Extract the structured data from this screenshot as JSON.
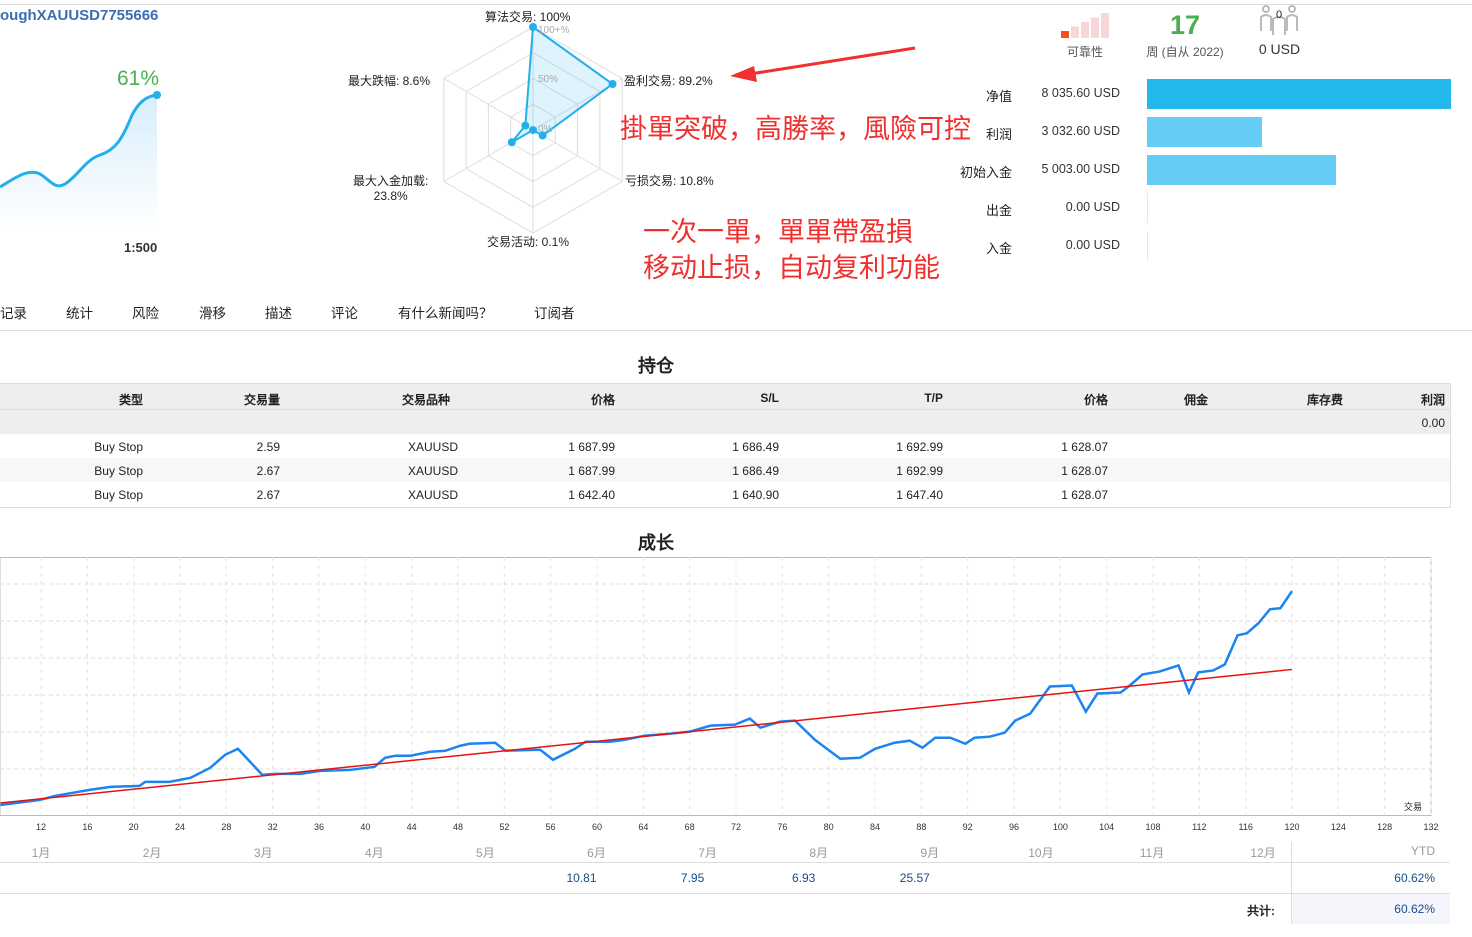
{
  "header": {
    "title": "oughXAUUSD7755666",
    "growth_pct": "61%",
    "leverage": "1:500"
  },
  "radar": {
    "axes": [
      {
        "label": "算法交易: 100%",
        "value": 100
      },
      {
        "label": "盈利交易: 89.2%",
        "value": 89.2
      },
      {
        "label": "亏损交易: 10.8%",
        "value": 10.8
      },
      {
        "label": "交易活动: 0.1%",
        "value": 0.1
      },
      {
        "label": "最大入金加载:",
        "label2": "23.8%",
        "value": 23.8
      },
      {
        "label": "最大跌幅: 8.6%",
        "value": 8.6
      }
    ],
    "ring_labels": [
      "100+%",
      "50%",
      "0%"
    ]
  },
  "annotations": {
    "line1": "掛單突破，高勝率，風險可控",
    "line2": "一次一單，單單帶盈損",
    "line3": "移动止损，自动复利功能"
  },
  "stats": {
    "reliability_label": "可靠性",
    "reliability_level": 1,
    "reliability_max": 5,
    "weeks": "17",
    "weeks_label": "周 (自从 2022)",
    "subscribers": "0",
    "subscription_price": "0 USD"
  },
  "finance": [
    {
      "label": "净值",
      "value": "8 035.60 USD",
      "amount": 8035.6,
      "color": "#22b8ec"
    },
    {
      "label": "利润",
      "value": "3 032.60 USD",
      "amount": 3032.6,
      "color": "#63cdf5"
    },
    {
      "label": "初始入金",
      "value": "5 003.00 USD",
      "amount": 5003.0,
      "color": "#63cdf5"
    },
    {
      "label": "出金",
      "value": "0.00 USD",
      "amount": 0,
      "color": "#63cdf5"
    },
    {
      "label": "入金",
      "value": "0.00 USD",
      "amount": 0,
      "color": "#63cdf5"
    }
  ],
  "tabs": [
    "记录",
    "统计",
    "风险",
    "滑移",
    "描述",
    "评论",
    "有什么新闻吗？",
    "订阅者"
  ],
  "positions": {
    "title": "持仓",
    "headers": [
      "类型",
      "交易量",
      "交易品种",
      "价格",
      "S/L",
      "T/P",
      "价格",
      "佣金",
      "库存费",
      "利润"
    ],
    "total_profit": "0.00",
    "rows": [
      [
        "Buy Stop",
        "2.59",
        "XAUUSD",
        "1 687.99",
        "1 686.49",
        "1 692.99",
        "1 628.07"
      ],
      [
        "Buy Stop",
        "2.67",
        "XAUUSD",
        "1 687.99",
        "1 686.49",
        "1 692.99",
        "1 628.07"
      ],
      [
        "Buy Stop",
        "2.67",
        "XAUUSD",
        "1 642.40",
        "1 640.90",
        "1 647.40",
        "1 628.07"
      ]
    ]
  },
  "growth": {
    "title": "成长",
    "x_axis_label": "交易",
    "chart_data": {
      "type": "line",
      "title": "成长",
      "xlabel": "交易",
      "xlim": [
        8.46,
        132
      ],
      "ylim": [
        -10,
        247
      ],
      "xticks": [
        12,
        16,
        20,
        24,
        28,
        32,
        36,
        40,
        44,
        48,
        52,
        56,
        60,
        64,
        68,
        72,
        76,
        80,
        84,
        88,
        92,
        96,
        100,
        104,
        108,
        112,
        116,
        120,
        124,
        128,
        132
      ],
      "series": [
        {
          "name": "growth",
          "color": "#1a84f0",
          "x": [
            8.5,
            11.9,
            13.2,
            16.2,
            18.0,
            20.5,
            21.0,
            23.1,
            24.9,
            26.6,
            27.9,
            29.0,
            31.1,
            32.2,
            34.4,
            36.1,
            38.7,
            40.8,
            41.7,
            42.6,
            43.9,
            45.6,
            46.9,
            48.2,
            49.0,
            51.2,
            52.1,
            55.1,
            56.2,
            58.1,
            59.0,
            61.1,
            62.4,
            64.1,
            66.3,
            68.0,
            69.8,
            71.9,
            73.2,
            74.1,
            75.8,
            77.1,
            78.8,
            81.0,
            82.7,
            84.0,
            85.7,
            87.0,
            88.1,
            89.2,
            90.5,
            91.8,
            92.6,
            93.9,
            95.2,
            96.1,
            97.4,
            99.1,
            101.0,
            102.2,
            103.2,
            105.2,
            106.0,
            107.1,
            108.6,
            110.2,
            111.1,
            111.9,
            113.2,
            114.2,
            115.3,
            116.1,
            117.1,
            118.1,
            119.0,
            120
          ],
          "y": [
            0,
            5,
            9,
            15,
            18,
            19,
            23,
            23,
            27,
            37,
            50,
            56,
            30,
            31,
            31,
            34,
            35,
            38,
            47,
            49,
            49,
            53,
            54,
            59,
            61,
            62,
            54,
            55,
            45,
            56,
            63,
            63,
            65,
            69,
            71,
            73,
            79,
            80,
            86,
            77,
            83,
            84,
            65,
            46,
            47,
            56,
            62,
            64,
            57,
            67,
            67,
            61,
            67,
            68,
            72,
            84,
            91,
            118,
            119,
            93,
            111,
            112,
            119,
            130,
            133,
            139,
            112,
            132,
            134,
            140,
            169,
            171,
            181,
            195,
            196,
            213
          ]
        },
        {
          "name": "trend",
          "color": "#e81010",
          "x": [
            8.5,
            120
          ],
          "y": [
            2,
            135
          ]
        }
      ]
    }
  },
  "monthly": {
    "months": [
      "1月",
      "2月",
      "3月",
      "4月",
      "5月",
      "6月",
      "7月",
      "8月",
      "9月",
      "10月",
      "11月",
      "12月"
    ],
    "ytd_label": "YTD",
    "values": [
      "",
      "",
      "",
      "",
      "",
      "10.81",
      "7.95",
      "6.93",
      "25.57",
      "",
      "",
      ""
    ],
    "ytd": "60.62%",
    "total_label": "共计:",
    "total": "60.62%"
  }
}
